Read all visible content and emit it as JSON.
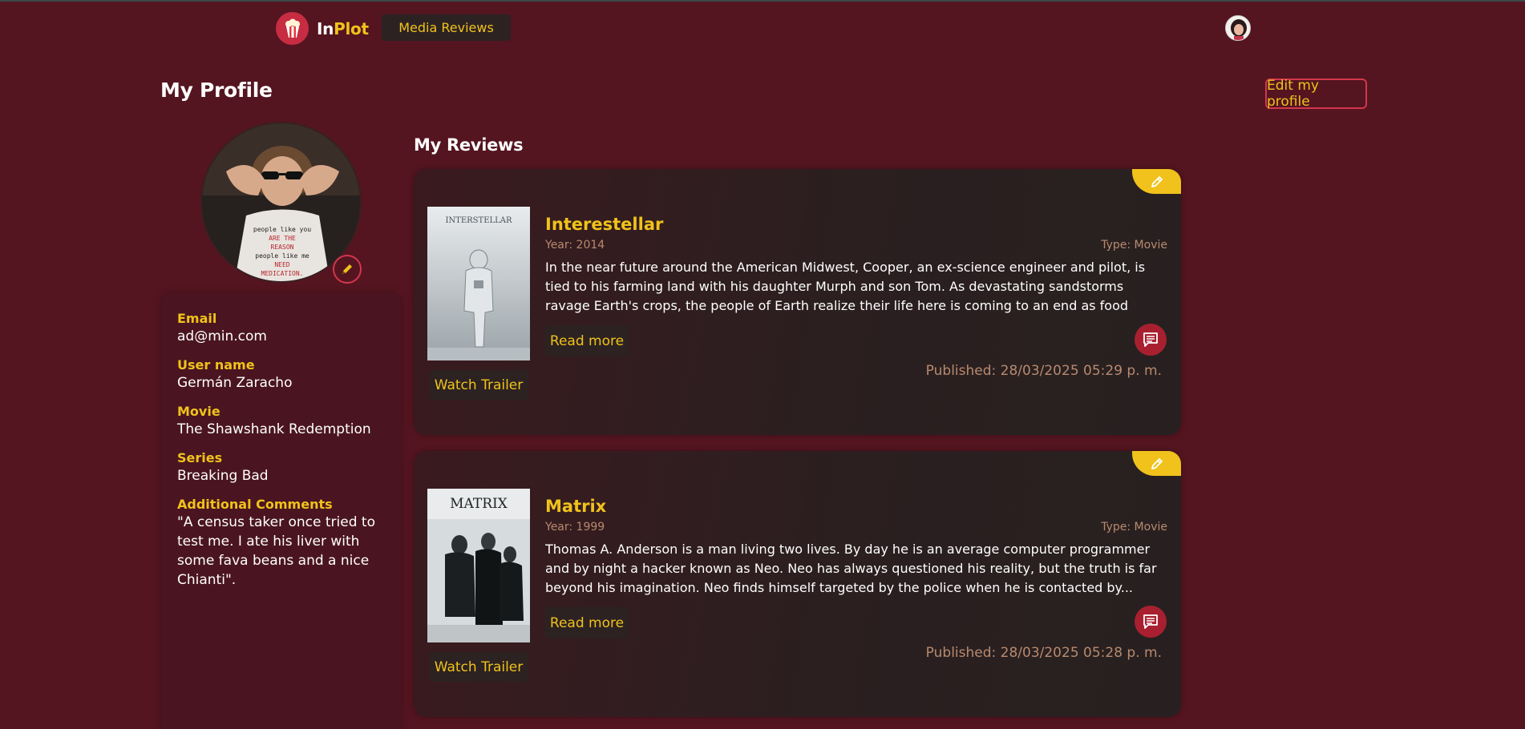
{
  "nav": {
    "logo_in": "In",
    "logo_plot": "Plot",
    "media_reviews": "Media Reviews"
  },
  "profile": {
    "title": "My Profile",
    "edit_button": "Edit my profile",
    "fields": [
      {
        "label": "Email",
        "value": "ad@min.com"
      },
      {
        "label": "User name",
        "value": "Germán Zaracho"
      },
      {
        "label": "Movie",
        "value": "The Shawshank Redemption"
      },
      {
        "label": "Series",
        "value": "Breaking Bad"
      },
      {
        "label": "Additional Comments",
        "value": "\"A census taker once tried to test me. I ate his liver with some fava beans and a nice Chianti\"."
      }
    ]
  },
  "reviews": {
    "title": "My Reviews",
    "items": [
      {
        "title": "Interestellar",
        "year": "Year: 2014",
        "type": "Type: Movie",
        "description": "In the near future around the American Midwest, Cooper, an ex-science engineer and pilot, is tied to his farming land with his daughter Murph and son Tom. As devastating sandstorms ravage Earth's crops, the people of Earth realize their life here is coming to an end as food begin...",
        "poster_text": "INTERSTELLAR",
        "read_more": "Read more",
        "watch_trailer": "Watch Trailer",
        "published": "Published: 28/03/2025 05:29 p. m."
      },
      {
        "title": "Matrix",
        "year": "Year: 1999",
        "type": "Type: Movie",
        "description": "Thomas A. Anderson is a man living two lives. By day he is an average computer programmer and by night a hacker known as Neo. Neo has always questioned his reality, but the truth is far beyond his imagination. Neo finds himself targeted by the police when he is contacted by...",
        "poster_text": "MATRIX",
        "read_more": "Read more",
        "watch_trailer": "Watch Trailer",
        "published": "Published: 28/03/2025 05:28 p. m."
      }
    ]
  },
  "colors": {
    "background": "#541520",
    "accent_yellow": "#f0c21b",
    "accent_red": "#d2374d",
    "button_dark": "#2c2222"
  },
  "icons": {
    "logo": "popcorn-icon",
    "edit": "pencil-icon",
    "comment": "comment-icon"
  }
}
